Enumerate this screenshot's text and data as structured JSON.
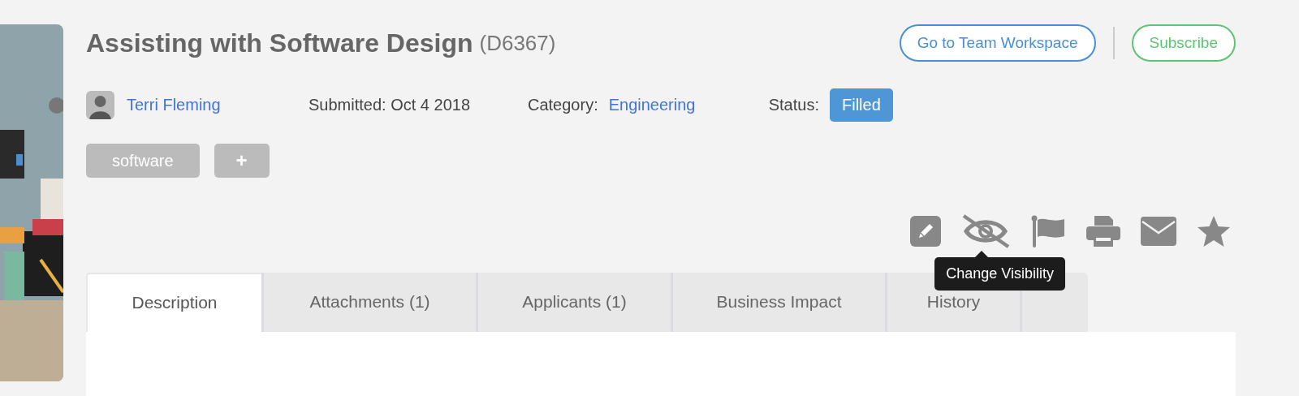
{
  "header": {
    "title": "Assisting with Software Design",
    "id": "(D6367)"
  },
  "actions": [
    {
      "label": "Go to Team Workspace",
      "kind": "primary"
    },
    {
      "label": "Subscribe",
      "kind": "success"
    }
  ],
  "meta": {
    "author": "Terri Fleming",
    "submitted": "Submitted: Oct 4 2018",
    "category_label": "Category:",
    "category": "Engineering",
    "status_label": "Status:",
    "status": "Filled"
  },
  "tags": [
    {
      "label": "software",
      "kind": "tag"
    },
    {
      "label": "+",
      "kind": "add"
    }
  ],
  "toolbar": [
    {
      "kind": "edit"
    },
    {
      "kind": "visibility"
    },
    {
      "kind": "flag"
    },
    {
      "kind": "print"
    },
    {
      "kind": "email"
    },
    {
      "kind": "star"
    }
  ],
  "tooltip": {
    "text": "Change Visibility"
  },
  "tabs": [
    {
      "label": "Description",
      "selected": true
    },
    {
      "label": "Attachments (1)",
      "selected": false
    },
    {
      "label": "Applicants (1)",
      "selected": false
    },
    {
      "label": "Business Impact",
      "selected": false
    },
    {
      "label": "History",
      "selected": false
    },
    {
      "selected": false
    }
  ]
}
